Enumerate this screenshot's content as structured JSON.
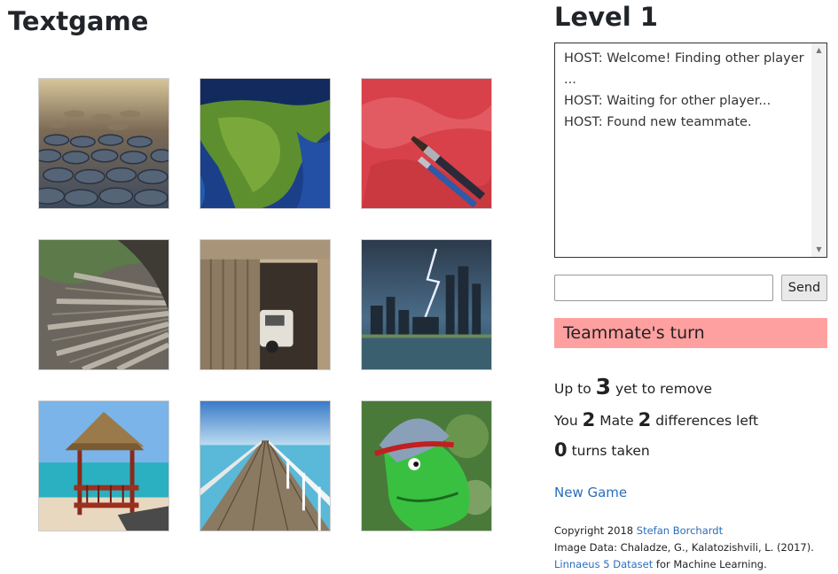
{
  "app": {
    "title": "Textgame"
  },
  "tiles": [
    {
      "name": "cobblestone"
    },
    {
      "name": "globe"
    },
    {
      "name": "paintbrush"
    },
    {
      "name": "spiral-stairs"
    },
    {
      "name": "garage-car"
    },
    {
      "name": "city-lightning"
    },
    {
      "name": "beach-hut"
    },
    {
      "name": "pier"
    },
    {
      "name": "frog-hat"
    }
  ],
  "side": {
    "level": "Level 1",
    "chat_lines": [
      "HOST: Welcome! Finding other player",
      "...",
      "HOST: Waiting for other player...",
      "HOST: Found new teammate."
    ],
    "input_value": "",
    "send_label": "Send",
    "turn": {
      "text": "Teammate's turn",
      "color": "#ffa0a0"
    },
    "remove": {
      "prefix": "Up to",
      "count": "3",
      "suffix": "yet to remove"
    },
    "diffs": {
      "you_label": "You",
      "you_count": "2",
      "mate_label": "Mate",
      "mate_count": "2",
      "suffix": "differences left"
    },
    "turns": {
      "count": "0",
      "suffix": "turns taken"
    },
    "new_game": "New Game",
    "credits": {
      "copyright": "Copyright 2018",
      "author": "Stefan Borchardt",
      "image_data": "Image Data: Chaladze, G., Kalatozishvili, L. (2017).",
      "dataset": "Linnaeus 5 Dataset",
      "dataset_suffix": "for Machine Learning."
    }
  },
  "colors": {
    "link": "#2a6ebb",
    "turn_bg": "#ffa0a0"
  }
}
